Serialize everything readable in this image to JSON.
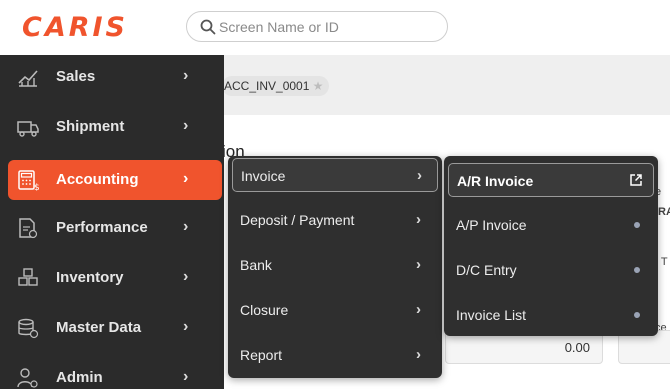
{
  "brand": {
    "logo_text": "CARIS",
    "accent_color": "#f0542d"
  },
  "search": {
    "placeholder": "Screen Name or ID",
    "icon": "search-icon"
  },
  "tabs": {
    "current_tab": "ACC_INV_0001"
  },
  "content": {
    "title_fragment": "ion",
    "amount": "0.00",
    "fragments": [
      "e",
      "RA",
      "t T",
      "ce"
    ]
  },
  "sidebar": {
    "items": [
      {
        "label": "Sales",
        "icon": "sales-chart-icon"
      },
      {
        "label": "Shipment",
        "icon": "truck-icon"
      },
      {
        "label": "Accounting",
        "icon": "calculator-icon",
        "active": true
      },
      {
        "label": "Performance",
        "icon": "report-icon"
      },
      {
        "label": "Inventory",
        "icon": "boxes-icon"
      },
      {
        "label": "Master Data",
        "icon": "database-icon"
      },
      {
        "label": "Admin",
        "icon": "user-gear-icon"
      }
    ]
  },
  "accounting_menu": {
    "items": [
      {
        "label": "Invoice",
        "active": true
      },
      {
        "label": "Deposit / Payment"
      },
      {
        "label": "Bank"
      },
      {
        "label": "Closure"
      },
      {
        "label": "Report"
      }
    ]
  },
  "invoice_menu": {
    "items": [
      {
        "label": "A/R Invoice",
        "active": true,
        "icon": "external-link-icon"
      },
      {
        "label": "A/P Invoice"
      },
      {
        "label": "D/C Entry"
      },
      {
        "label": "Invoice List"
      }
    ]
  }
}
